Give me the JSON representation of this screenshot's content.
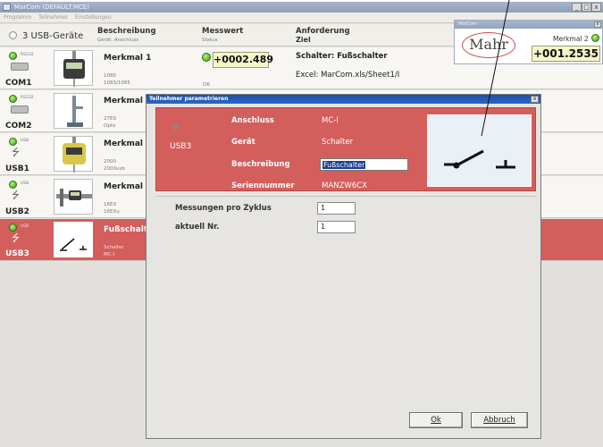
{
  "window": {
    "title": "MarCom  (DEFAULT.MCE)",
    "minimize": "_",
    "maximize": "□",
    "close": "x"
  },
  "menu": [
    "Programm",
    "Teilnehmer",
    "Einstellungen"
  ],
  "header": {
    "device_count": "3 USB-Geräte",
    "col_desc": "Beschreibung",
    "col_desc_sub": "Gerät, Anschluss",
    "col_value": "Messwert",
    "col_value_sub": "Status",
    "col_req": "Anforderung",
    "col_req_sub": "Ziel"
  },
  "rows": [
    {
      "port_tag": "RS232",
      "port": "COM1",
      "name": "Merkmal 1",
      "sub1": "1085",
      "sub2": "1083/1085"
    },
    {
      "port_tag": "RS232",
      "port": "COM2",
      "name": "Merkmal 2",
      "sub1": "27ES",
      "sub2": "Opto"
    },
    {
      "port_tag": "USB",
      "port": "USB1",
      "name": "Merkmal",
      "sub1": "2000",
      "sub2": "2000usb"
    },
    {
      "port_tag": "USB",
      "port": "USB2",
      "name": "Merkmal",
      "sub1": "16EX",
      "sub2": "16EXu"
    },
    {
      "port_tag": "USB",
      "port": "USB3",
      "name": "Fußschalter",
      "sub1": "Schalter",
      "sub2": "MC-I"
    }
  ],
  "measure": {
    "value": "+0002.489",
    "status": "OK"
  },
  "requirement": {
    "line1": "Schalter: Fußschalter",
    "line2": "Excel: MarCom.xls/Sheet1/I"
  },
  "widget": {
    "title": "MarCom",
    "close": "x",
    "logo": "Mahr",
    "label": "Merkmal 2",
    "value": "+001.2535"
  },
  "dialog": {
    "title": "Teilnehmer parametrieren",
    "close": "x",
    "port": "USB3",
    "labels": {
      "anschluss": "Anschluss",
      "geraet": "Gerät",
      "beschreibung": "Beschreibung",
      "serien": "Seriennummer"
    },
    "values": {
      "anschluss": "MC-I",
      "geraet": "Schalter",
      "beschreibung": "Fußschalter",
      "serien": "MANZW6CX"
    },
    "meas_label": "Messungen pro Zyklus",
    "meas_value": "1",
    "current_label": "aktuell Nr.",
    "current_value": "1",
    "ok": "Ok",
    "cancel": "Abbruch"
  },
  "colors": {
    "selection_red": "#d45e5c",
    "title_blue": "#1d4ea3",
    "value_yellow": "#f6f6c9",
    "led_green": "#3c9d17"
  },
  "icons": [
    "usb-icon",
    "rs232-icon",
    "footswitch-icon",
    "dial-indicator-icon",
    "height-gauge-icon",
    "caliper-icon",
    "status-led-icon"
  ]
}
